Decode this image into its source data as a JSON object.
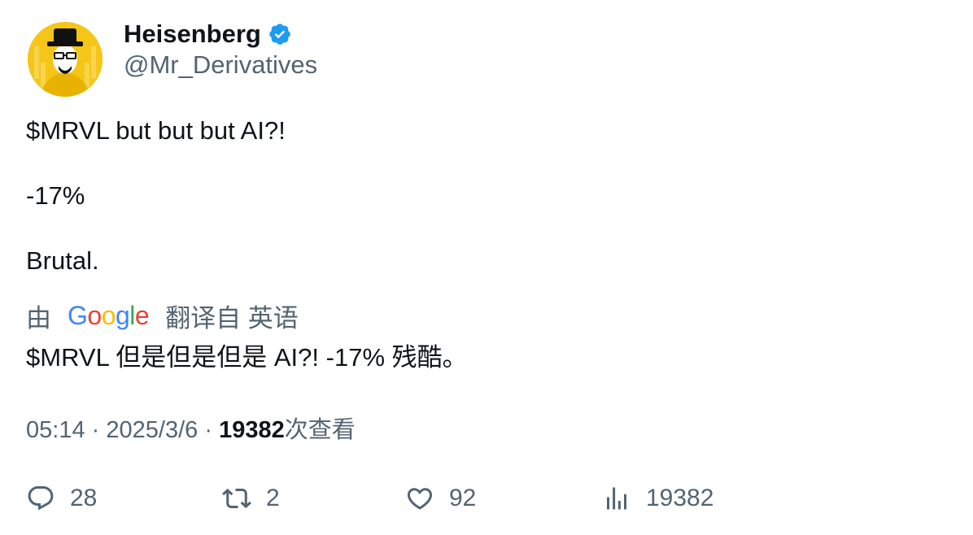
{
  "author": {
    "display_name": "Heisenberg",
    "handle": "@Mr_Derivatives",
    "verified_icon": "verified-badge-icon",
    "verified_color": "#1d9bf0",
    "avatar_bg": "#f5c518"
  },
  "tweet": {
    "lines": [
      "$MRVL but but but AI?!",
      "-17%",
      "Brutal."
    ]
  },
  "translation": {
    "prefix": "由",
    "logo": [
      "G",
      "o",
      "o",
      "g",
      "l",
      "e"
    ],
    "suffix": "翻译自 英语",
    "text": "$MRVL 但是但是但是 AI?! -17% 残酷。"
  },
  "meta": {
    "time": "05:14",
    "separator": "·",
    "date": "2025/3/6",
    "views_count": "19382",
    "views_label": "次查看"
  },
  "actions": {
    "replies": "28",
    "reposts": "2",
    "likes": "92",
    "views": "19382"
  }
}
